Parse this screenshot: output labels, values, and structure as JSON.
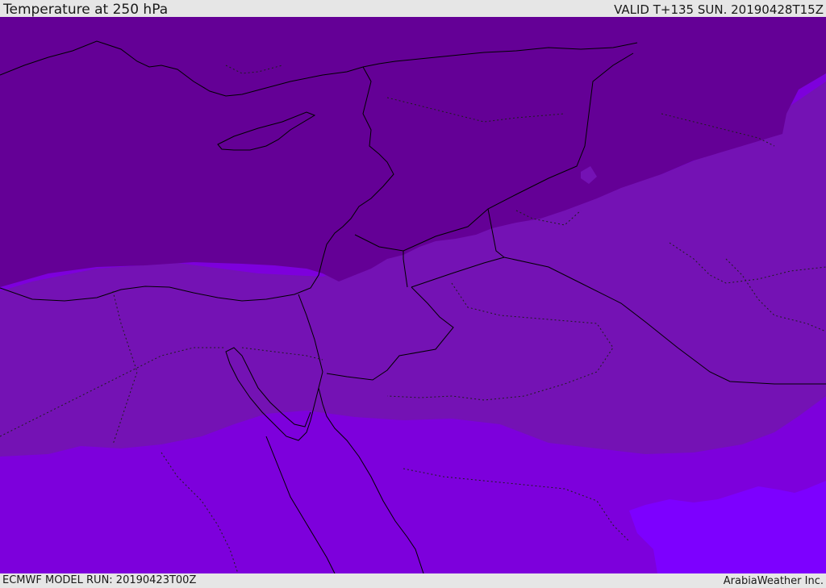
{
  "header": {
    "title": "Temperature at 250 hPa",
    "valid": "VALID T+135 SUN. 20190428T15Z"
  },
  "footer": {
    "model_run": "ECMWF MODEL RUN: 20190423T00Z",
    "credit": "ArabiaWeather Inc."
  },
  "map": {
    "colors": {
      "coldest": "#640096",
      "cold": "#7412b4",
      "mild": "#7d00dc",
      "warm": "#7d00ff",
      "border": "#000000",
      "admin_border": "#1e1e1e"
    }
  }
}
